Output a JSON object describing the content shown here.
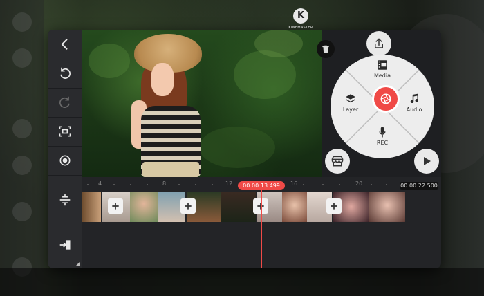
{
  "app": {
    "name": "KineMaster",
    "logo_text": "KINEMASTER",
    "logo_letter": "K"
  },
  "toolbar": {
    "items": [
      {
        "name": "back",
        "icon": "chevron-left-icon"
      },
      {
        "name": "undo",
        "icon": "undo-icon"
      },
      {
        "name": "redo",
        "icon": "redo-icon",
        "disabled": true
      },
      {
        "name": "crop",
        "icon": "crop-frame-icon"
      },
      {
        "name": "capture",
        "icon": "target-icon"
      }
    ]
  },
  "media_wheel": {
    "media_label": "Media",
    "layer_label": "Layer",
    "audio_label": "Audio",
    "rec_label": "REC",
    "center_icon": "camera-shutter-icon"
  },
  "timeline": {
    "current_time": "00:00:13.499",
    "duration": "00:00:22.500",
    "ruler_ticks": [
      "4",
      "8",
      "12",
      "16",
      "20"
    ]
  },
  "colors": {
    "accent": "#f04a47",
    "panel": "#1e1f22",
    "wheel": "#ededed"
  }
}
